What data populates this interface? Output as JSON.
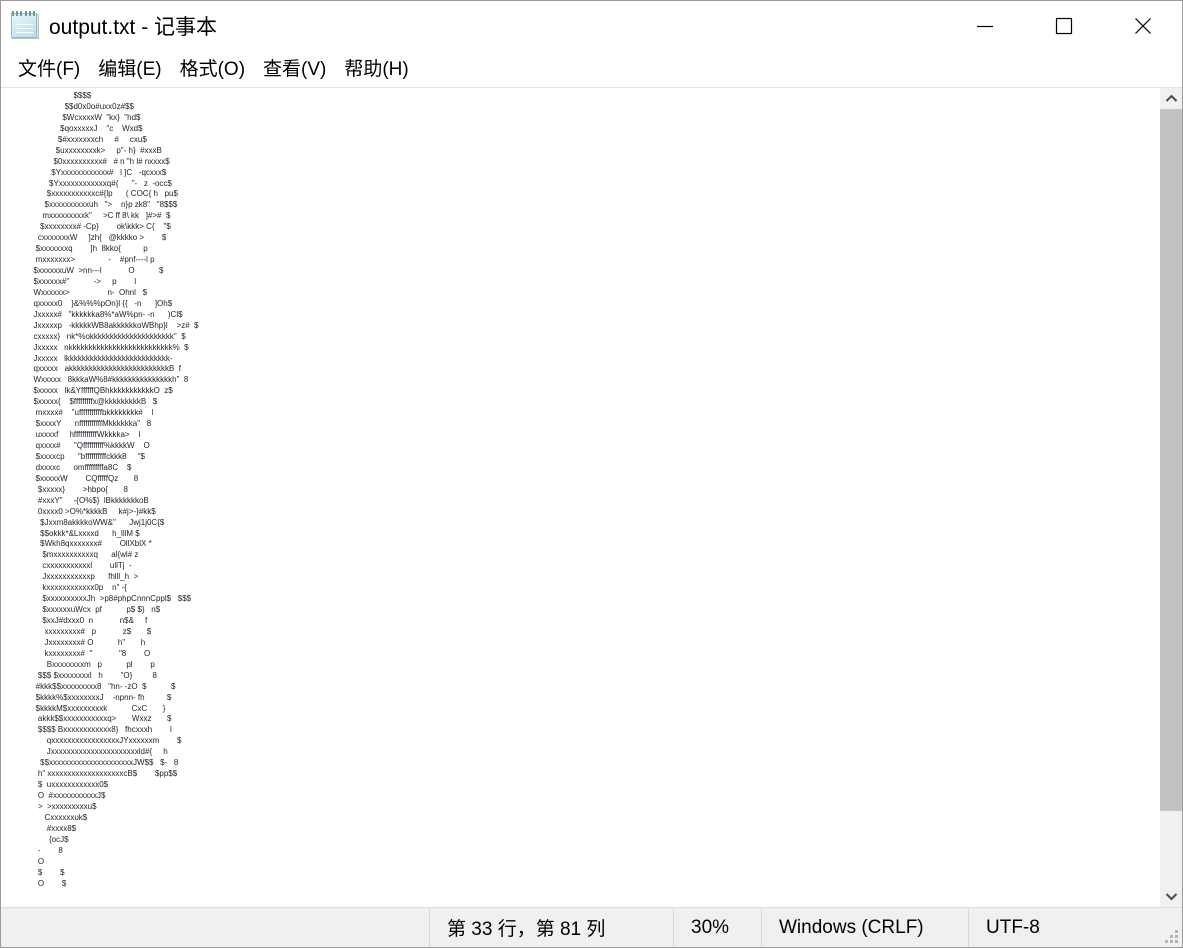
{
  "window": {
    "title": "output.txt - 记事本",
    "icon": "notepad-icon",
    "caption_buttons": [
      {
        "name": "minimize",
        "label": "—"
      },
      {
        "name": "maximize",
        "label": "□"
      },
      {
        "name": "close",
        "label": "✕"
      }
    ]
  },
  "menubar": {
    "items": [
      {
        "label": "文件(F)"
      },
      {
        "label": "编辑(E)"
      },
      {
        "label": "格式(O)"
      },
      {
        "label": "查看(V)"
      },
      {
        "label": "帮助(H)"
      }
    ]
  },
  "editor": {
    "content": "                    $$$$\n                $$d0x0o#uxx0z#$$\n               $WcxxxxW  \"kx}  \"hd$\n              $qoxxxxxJ    \"c    Wxd$\n             $#xxxxxxxch     #     cxu$\n            $uxxxxxxxxk>     p\"- h}  #xxxB\n           $0xxxxxxxxxx#   # n \"h l# nxxxx$\n          $Yxxxxxxxxxxxx#   l ]C   -qcxxx$\n         $Yxxxxxxxxxxxxq#{      \"-   z  -occ$\n        $xxxxxxxxxxxc#{lp      ( COC{ h   pu$\n       $xxxxxxxxxxuh   \">    n}p zk8\"   \"8$$$\n      mxxxxxxxxxk\"     >C ff 8\\ kk   ]#>#  $\n     $xxxxxxxx# -Cp}        ok\\kkk> C{    \"$\n    cxxxxxxxW     ]zh{   @kkkko >        $\n   $xxxxxxxq        ]h  8kko{          p\n   mxxxxxxx>               -    #pnf----l p\n  $xxxxxxuW  >nn---l            O           $\n  $xxxxxx#\"           ->     p        l\n  Wxxxxxx>                 n-  Ohnl   $\n  qxxxxx0    }&%%%pOn}l {{   -n      ]Oh$\n  Jxxxxx#   \"kkkkkka8%*aW%pn- -n      )Cl$\n  Jxxxxxp   -kkkkkWB8akkkkkkoWBhp}l    >z#  $\n  cxxxxx}   nk*%okkkkkkkkkkkkkkkkkkkkk\"  $\n  Jxxxxx   nkkkkkkkkkkkkkkkkkkkkkkkkkk%  $\n  Jxxxxx   lkkkkkkkkkkkkkkkkkkkkkkkkkk-\n  qxxxxx   akkkkkkkkkkkkkkkkkkkkkkkkkB  f\n  Wxxxxx   8kkkaW%8#kkkkkkkkkkkkkkkh\"  8\n  $xxxxx   lk&YffffffQBhkkkkkkkkkkkO  z$\n  $xxxxx{    $fffffffffx@kkkkkkkkkB   $\n   mxxxx#    \"ufffffffffffbkkkkkkkk#    l\n   $xxxxY      nfffffffffffMkkkkkka\"   8\n   uxxxxf     hfffffffffffWkkkka>    l\n   qxxxx#      \"Qffffffffff%kkkkW    O\n   $xxxxcp      \"bffffffffffckkk8     \"$\n   dxxxxc      omfffffffffa8C    $\n   $xxxxxW        CQfffffQz       8\n    $xxxxx}        >hbpo{       8\n    #xxxY\"     -{O%$}  lBkkkkkkkoB\n    0xxxx0 >O%*kkkkB     k#j>-}#kk$\n     $Jxxm8akkkkoWW&\"      Jwj1j0C{$\n     $$okkk*&Lxxxxd      h_lllM $\n     $Wkh8qxxxxxxx#        OllXblX *\n      $mxxxxxxxxxxq      al{wl# z\n      cxxxxxxxxxxxl        ullTj  -\n      Jxxxxxxxxxxxp      fhlll_h  >\n      kxxxxxxxxxxxx0p    n\" -{\n      $xxxxxxxxxxJh  >p8#phpCnnnCppl$   $$$\n      $xxxxxxuWcx  pf           p$ $}   n$\n      $xxJ#dxxx0  n            n$&     f\n       xxxxxxxxx#   p            z$       $\n       Jxxxxxxxx# O           h\"       h\n       kxxxxxxxx#  \"            \"8        O\n        Bxxxxxxxxm   p           pl        p\n    $$$ $xxxxxxxxl   h        \"O}         8\n   #kkk$$xxxxxxxxx8   \"hn- -zO  $           $\n   $kkkk%$xxxxxxxxJ    -npnn- fh          $\n   $kkkkM$xxxxxxxxxk           CxC       }\n    akkk$$xxxxxxxxxxxq>       Wxxz       $\n    $$$$ Bxxxxxxxxxxxx8}   fhcxxxh        l\n        qxxxxxxxxxxxxxxxxxJYxxxxxxm        $\n        Jxxxxxxxxxxxxxxxxxxxxxxld#{     h\n     $$xxxxxxxxxxxxxxxxxxxxxJW$$   $-   8\n    h\" xxxxxxxxxxxxxxxxxxxcB$        $pp$$\n    $  uxxxxxxxxxxxx0$\n    O  #xxxxxxxxxxxJ$\n    >  >xxxxxxxxxu$\n       Cxxxxxxuk$\n        #xxxx8$\n         {ocJ$\n    -        8\n    O\n    $        $\n    O        $",
    "font_size_label": "30%"
  },
  "scrollbar": {
    "up_arrow": "chevron-up-icon",
    "down_arrow": "chevron-down-icon"
  },
  "statusbar": {
    "cursor_position": "第 33 行，第 81 列",
    "zoom": "30%",
    "line_ending": "Windows (CRLF)",
    "encoding": "UTF-8"
  },
  "colors": {
    "window_bg": "#ffffff",
    "chrome_bg": "#f0f0f0",
    "text": "#000000",
    "scroll_thumb": "#c2c2c2",
    "border": "#9b9b9b"
  }
}
